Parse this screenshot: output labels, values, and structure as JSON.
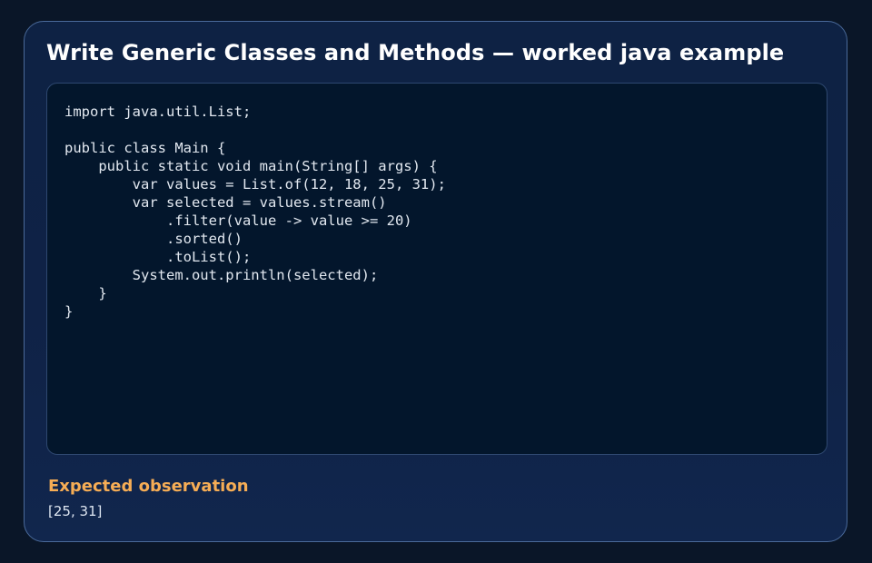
{
  "card": {
    "title": "Write Generic Classes and Methods — worked java example"
  },
  "code": {
    "language": "java",
    "source": "import java.util.List;\n\npublic class Main {\n    public static void main(String[] args) {\n        var values = List.of(12, 18, 25, 31);\n        var selected = values.stream()\n            .filter(value -> value >= 20)\n            .sorted()\n            .toList();\n        System.out.println(selected);\n    }\n}"
  },
  "observation": {
    "label": "Expected observation",
    "value": "[25, 31]"
  },
  "colors": {
    "page_background": "#0a1628",
    "card_background": "#0f2246",
    "card_border": "#4a6a9a",
    "code_background": "#03162c",
    "title_text": "#ffffff",
    "accent_orange": "#f6ad55"
  }
}
